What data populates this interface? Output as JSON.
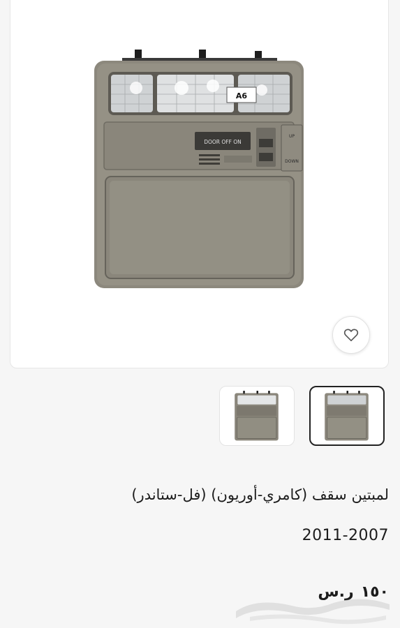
{
  "product": {
    "title": "لمبتين سقف (كامري-أوريون) (فل-ستاندر)",
    "years": "2011-2007",
    "price_value": "١٥٠",
    "currency": "ر.س"
  },
  "image_labels": {
    "part_code": "A6",
    "door_switch": "DOOR OFF ON",
    "up": "UP",
    "down": "DOWN"
  },
  "icons": {
    "favorite": "heart-icon"
  },
  "colors": {
    "console_gray": "#8a867b",
    "card_bg": "#ffffff",
    "page_bg": "#f6f6f6"
  }
}
